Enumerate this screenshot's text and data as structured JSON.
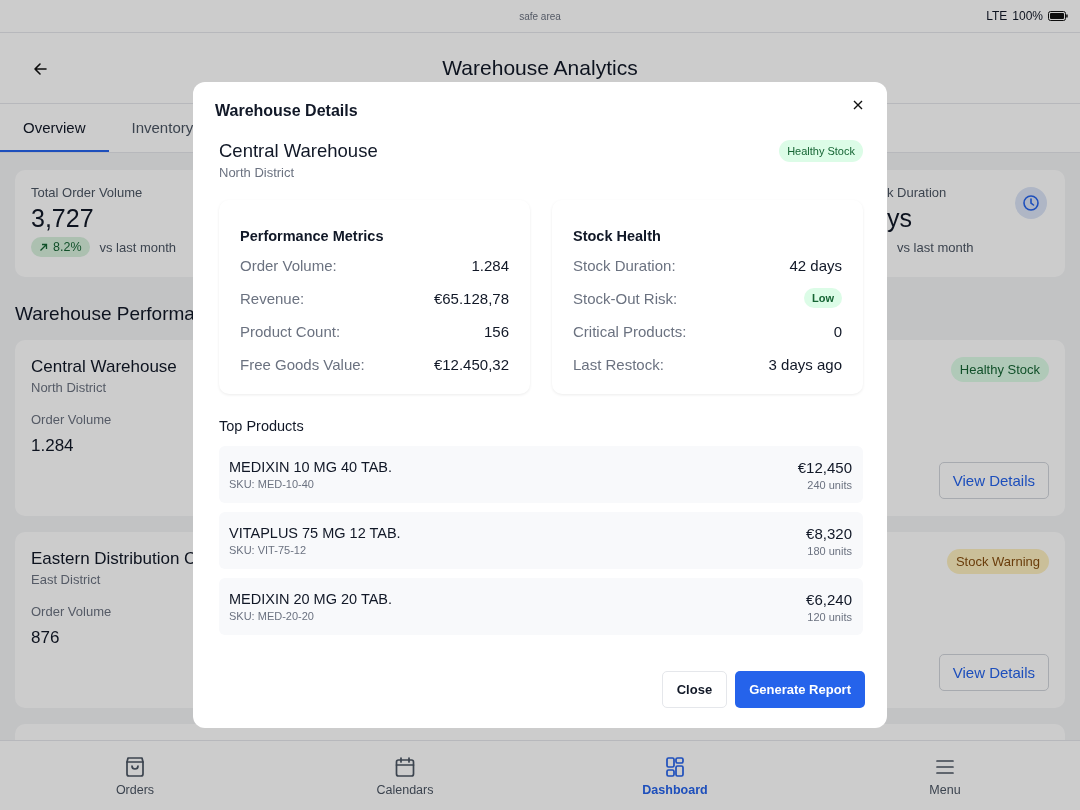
{
  "status_bar": {
    "label": "safe area",
    "network": "LTE",
    "battery": "100%"
  },
  "header": {
    "title": "Warehouse Analytics"
  },
  "tabs": [
    {
      "label": "Overview",
      "selected": true
    },
    {
      "label": "Inventory",
      "selected": false
    }
  ],
  "summary_cards": [
    {
      "label": "Total Order Volume",
      "value": "3,727",
      "change": "8.2%",
      "comparison": "vs last month"
    },
    {
      "label": "k Duration",
      "value": "ys",
      "comparison": "vs last month"
    }
  ],
  "section_title": "Warehouse Performa",
  "warehouses": [
    {
      "name": "Central Warehouse",
      "district": "North District",
      "metric_label": "Order Volume",
      "metric_value": "1.284",
      "status": {
        "label": "Healthy Stock",
        "kind": "healthy"
      },
      "action": "View Details"
    },
    {
      "name": "Eastern Distribution C",
      "district": "East District",
      "metric_label": "Order Volume",
      "metric_value": "876",
      "status": {
        "label": "Stock Warning",
        "kind": "warning"
      },
      "action": "View Details"
    }
  ],
  "bottom_nav": [
    {
      "label": "Orders",
      "selected": false
    },
    {
      "label": "Calendars",
      "selected": false
    },
    {
      "label": "Dashboard",
      "selected": true
    },
    {
      "label": "Menu",
      "selected": false
    }
  ],
  "modal": {
    "title": "Warehouse Details",
    "warehouse_name": "Central Warehouse",
    "district": "North District",
    "status": {
      "label": "Healthy Stock",
      "kind": "healthy"
    },
    "panels": [
      {
        "title": "Performance Metrics",
        "rows": [
          {
            "label": "Order Volume:",
            "value": "1.284",
            "kind": "text"
          },
          {
            "label": "Revenue:",
            "value": "€65.128,78",
            "kind": "text"
          },
          {
            "label": "Product Count:",
            "value": "156",
            "kind": "text"
          },
          {
            "label": "Free Goods Value:",
            "value": "€12.450,32",
            "kind": "text"
          }
        ]
      },
      {
        "title": "Stock Health",
        "rows": [
          {
            "label": "Stock Duration:",
            "value": "42 days",
            "kind": "text"
          },
          {
            "label": "Stock-Out Risk:",
            "value": "Low",
            "kind": "badge"
          },
          {
            "label": "Critical Products:",
            "value": "0",
            "kind": "text"
          },
          {
            "label": "Last Restock:",
            "value": "3 days ago",
            "kind": "text"
          }
        ]
      }
    ],
    "products_title": "Top Products",
    "products": [
      {
        "name": "MEDIXIN 10 MG 40 TAB.",
        "sku": "SKU: MED-10-40",
        "amount": "€12,450",
        "units": "240 units"
      },
      {
        "name": "VITAPLUS 75 MG 12 TAB.",
        "sku": "SKU: VIT-75-12",
        "amount": "€8,320",
        "units": "180 units"
      },
      {
        "name": "MEDIXIN 20 MG 20 TAB.",
        "sku": "SKU: MED-20-20",
        "amount": "€6,240",
        "units": "120 units"
      }
    ],
    "buttons": [
      {
        "label": "Close",
        "kind": "secondary"
      },
      {
        "label": "Generate Report",
        "kind": "primary"
      }
    ]
  }
}
